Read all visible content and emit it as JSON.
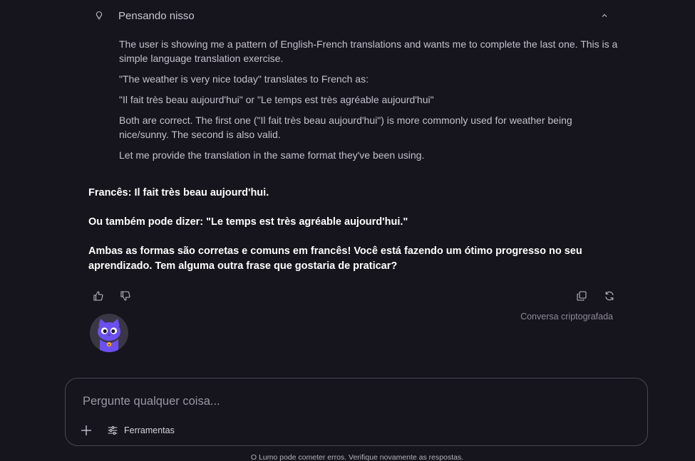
{
  "thinking": {
    "title": "Pensando nisso",
    "icon": "bulb-icon",
    "paragraphs": [
      "The user is showing me a pattern of English-French translations and wants me to complete the last one. This is a simple language translation exercise.",
      "\"The weather is very nice today\" translates to French as:",
      "\"Il fait très beau aujourd'hui\" or \"Le temps est très agréable aujourd'hui\"",
      "Both are correct. The first one (\"Il fait très beau aujourd'hui\") is more commonly used for weather being nice/sunny. The second is also valid.",
      "Let me provide the translation in the same format they've been using."
    ]
  },
  "answer": {
    "paragraphs": [
      "Francês: Il fait très beau aujourd'hui.",
      "Ou também pode dizer: \"Le temps est très agréable aujourd'hui.\"",
      "Ambas as formas são corretas e comuns em francês! Você está fazendo um ótimo progresso no seu aprendizado. Tem alguma outra frase que gostaria de praticar?"
    ]
  },
  "actions": {
    "encrypted_note": "Conversa criptografada"
  },
  "composer": {
    "placeholder": "Pergunte qualquer coisa...",
    "tools_label": "Ferramentas"
  },
  "footer": {
    "disclaimer": "O Lumo pode cometer erros. Verifique novamente as respostas."
  },
  "colors": {
    "background": "#16141c",
    "avatar_accent": "#6b4ff0"
  }
}
